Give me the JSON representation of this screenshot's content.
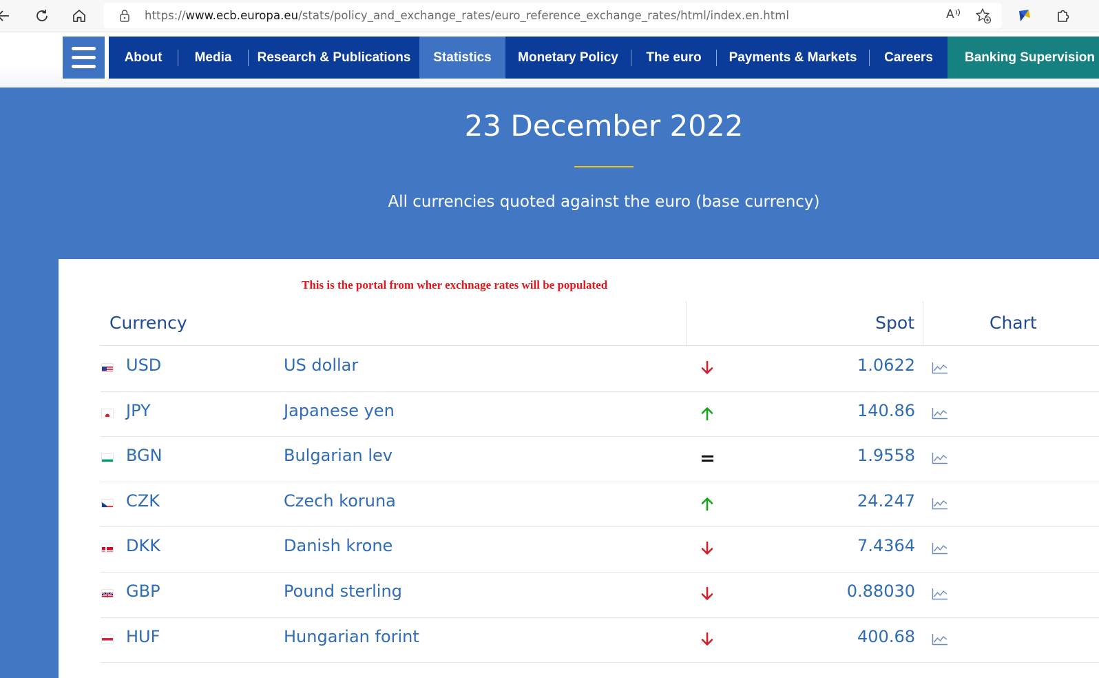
{
  "browser": {
    "url_prefix": "https://",
    "url_host": "www.ecb.europa.eu",
    "url_path": "/stats/policy_and_exchange_rates/euro_reference_exchange_rates/html/index.en.html",
    "read_aloud_label": "A"
  },
  "nav": {
    "items": [
      {
        "label": "About"
      },
      {
        "label": "Media"
      },
      {
        "label": "Research & Publications"
      },
      {
        "label": "Statistics"
      },
      {
        "label": "Monetary Policy"
      },
      {
        "label": "The euro"
      },
      {
        "label": "Payments & Markets"
      },
      {
        "label": "Careers"
      },
      {
        "label": "Banking Supervision"
      }
    ],
    "colors": {
      "nav_bg": "#0c3c9a",
      "active_bg": "#3e72c2",
      "banking_bg": "#178080"
    }
  },
  "hero": {
    "title": "23 December 2022",
    "subtitle": "All currencies quoted against the euro (base currency)",
    "bg_color": "#4277c4"
  },
  "note": "This is the portal from wher exchnage rates will be populated",
  "table": {
    "headers": {
      "currency": "Currency",
      "spot": "Spot",
      "chart": "Chart"
    },
    "rows": [
      {
        "code": "USD",
        "name": "US dollar",
        "trend": "down",
        "spot": "1.0622",
        "flag": "us-flag-icon"
      },
      {
        "code": "JPY",
        "name": "Japanese yen",
        "trend": "up",
        "spot": "140.86",
        "flag": "jp-flag-icon"
      },
      {
        "code": "BGN",
        "name": "Bulgarian lev",
        "trend": "equal",
        "spot": "1.9558",
        "flag": "bg-flag-icon"
      },
      {
        "code": "CZK",
        "name": "Czech koruna",
        "trend": "up",
        "spot": "24.247",
        "flag": "cz-flag-icon"
      },
      {
        "code": "DKK",
        "name": "Danish krone",
        "trend": "down",
        "spot": "7.4364",
        "flag": "dk-flag-icon"
      },
      {
        "code": "GBP",
        "name": "Pound sterling",
        "trend": "down",
        "spot": "0.88030",
        "flag": "gb-flag-icon"
      },
      {
        "code": "HUF",
        "name": "Hungarian forint",
        "trend": "down",
        "spot": "400.68",
        "flag": "hu-flag-icon"
      }
    ],
    "colors": {
      "up": "#19a319",
      "down": "#d0202b",
      "equal": "#111111",
      "link": "#2f6cb5"
    }
  }
}
